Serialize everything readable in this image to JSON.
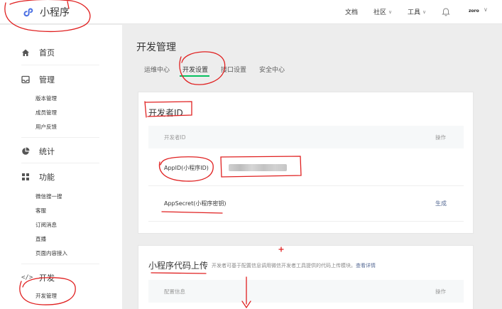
{
  "topbar": {
    "brand_name": "小程序",
    "menu": [
      {
        "label": "文档",
        "has_caret": false
      },
      {
        "label": "社区",
        "has_caret": true
      },
      {
        "label": "工具",
        "has_caret": true
      }
    ],
    "user_name": "zoro"
  },
  "sidebar": {
    "groups": [
      {
        "label": "首页",
        "icon": "home-icon"
      },
      {
        "label": "管理",
        "icon": "inbox-icon",
        "items": [
          "版本管理",
          "成员管理",
          "用户反馈"
        ]
      },
      {
        "label": "统计",
        "icon": "pie-chart-icon"
      },
      {
        "label": "功能",
        "icon": "grid-icon",
        "items": [
          "微信搜一搜",
          "客服",
          "订阅消息",
          "直播",
          "页面内容接入"
        ]
      },
      {
        "label": "开发",
        "icon": "code-icon",
        "items": [
          "开发管理"
        ]
      }
    ]
  },
  "main": {
    "title": "开发管理",
    "tabs": [
      "运维中心",
      "开发设置",
      "接口设置",
      "安全中心"
    ],
    "active_tab": "开发设置",
    "developer_id": {
      "title": "开发者ID",
      "col_id": "开发者ID",
      "col_action": "操作",
      "rows": [
        {
          "label": "AppID(小程序ID)",
          "value_hidden": true
        },
        {
          "label": "AppSecret(小程序密钥)",
          "action": "生成"
        }
      ]
    },
    "code_upload": {
      "title": "小程序代码上传",
      "description": "开发者可基于配置信息调用微信开发者工具提供的代码上传模块。",
      "description_link": "查看详情",
      "col_config": "配置信息",
      "col_action": "操作"
    }
  },
  "annotation_color": "#e02020",
  "accent_color": "#07c160",
  "link_color": "#576b95"
}
